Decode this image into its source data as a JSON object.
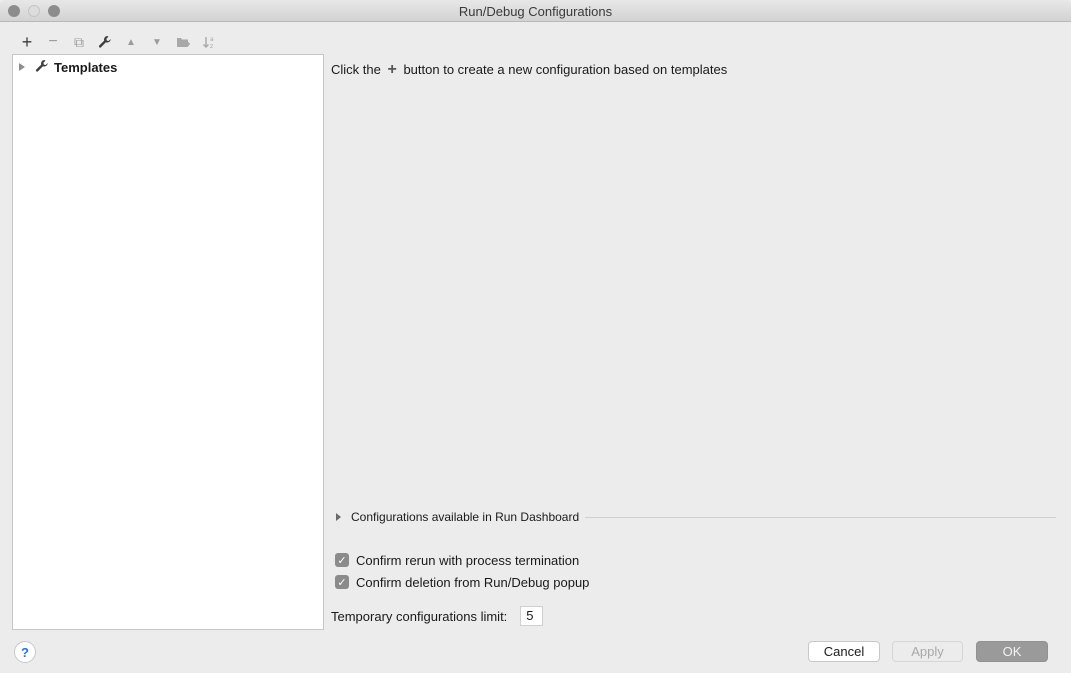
{
  "window": {
    "title": "Run/Debug Configurations"
  },
  "toolbar": {
    "items": [
      {
        "icon": "plus-icon",
        "glyph": "+",
        "enabled": true
      },
      {
        "icon": "minus-icon",
        "glyph": "−",
        "enabled": false
      },
      {
        "icon": "copy-icon",
        "glyph": "⧉",
        "enabled": false
      },
      {
        "icon": "wrench-icon",
        "glyph": "🔧",
        "enabled": true
      },
      {
        "icon": "move-up-icon",
        "glyph": "▲",
        "enabled": false
      },
      {
        "icon": "move-down-icon",
        "glyph": "▼",
        "enabled": false
      },
      {
        "icon": "new-folder-icon",
        "glyph": "▆",
        "enabled": false
      },
      {
        "icon": "sort-alpha-icon",
        "glyph": "↓ᶻ",
        "enabled": false
      }
    ]
  },
  "tree": {
    "items": [
      {
        "label": "Templates",
        "expanded": false
      }
    ]
  },
  "main": {
    "hint_before": "Click the",
    "hint_plus": "+",
    "hint_after": "button to create a new configuration based on templates",
    "dashboard_label": "Configurations available in Run Dashboard",
    "checks": [
      {
        "label": "Confirm rerun with process termination",
        "checked": true
      },
      {
        "label": "Confirm deletion from Run/Debug popup",
        "checked": true
      }
    ],
    "limit_label": "Temporary configurations limit:",
    "limit_value": "5"
  },
  "footer": {
    "help": "?",
    "cancel": "Cancel",
    "apply": "Apply",
    "ok": "OK"
  }
}
